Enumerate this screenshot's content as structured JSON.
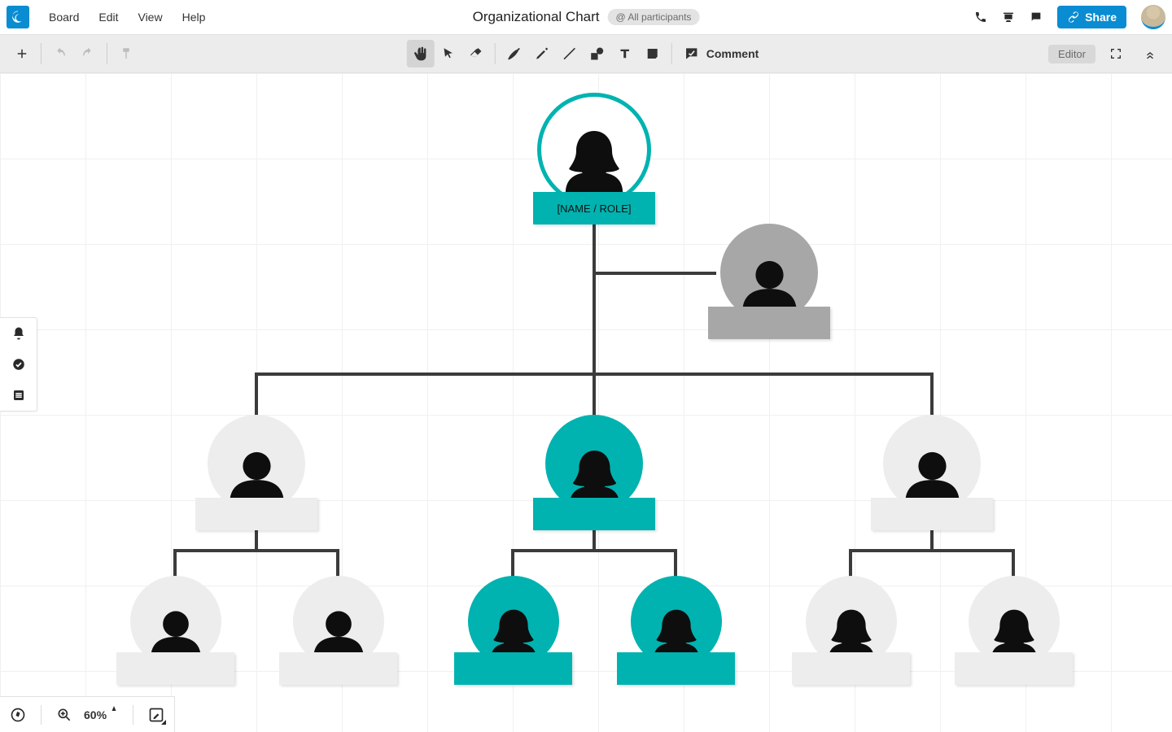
{
  "menu": {
    "board": "Board",
    "edit": "Edit",
    "view": "View",
    "help": "Help"
  },
  "doc": {
    "title": "Organizational Chart",
    "participants_label": "@ All participants"
  },
  "share": {
    "label": "Share"
  },
  "toolbar": {
    "comment_label": "Comment",
    "role_label": "Editor"
  },
  "bottom": {
    "zoom": "60%"
  },
  "colors": {
    "teal": "#00b3b0",
    "grey": "#a7a7a7",
    "light": "#ededed",
    "line": "#3b3b3b",
    "brand": "#0a8cd2"
  },
  "chart": {
    "root": {
      "label": "[NAME / ROLE]"
    }
  },
  "chart_data": {
    "type": "tree",
    "title": "Organizational Chart",
    "nodes": [
      {
        "id": "n1",
        "label": "[NAME / ROLE]",
        "gender": "female",
        "circle": "teal-ring",
        "plate": "teal",
        "parent": null
      },
      {
        "id": "n1a",
        "label": "",
        "gender": "male",
        "circle": "grey",
        "plate": "grey",
        "parent": "n1",
        "assistant": true
      },
      {
        "id": "n2",
        "label": "",
        "gender": "male",
        "circle": "light",
        "plate": "light",
        "parent": "n1"
      },
      {
        "id": "n3",
        "label": "",
        "gender": "female",
        "circle": "teal-fill",
        "plate": "teal",
        "parent": "n1"
      },
      {
        "id": "n4",
        "label": "",
        "gender": "male",
        "circle": "light",
        "plate": "light",
        "parent": "n1"
      },
      {
        "id": "n2a",
        "label": "",
        "gender": "male",
        "circle": "light",
        "plate": "light",
        "parent": "n2"
      },
      {
        "id": "n2b",
        "label": "",
        "gender": "male",
        "circle": "light",
        "plate": "light",
        "parent": "n2"
      },
      {
        "id": "n3a",
        "label": "",
        "gender": "female",
        "circle": "teal-fill",
        "plate": "teal",
        "parent": "n3"
      },
      {
        "id": "n3b",
        "label": "",
        "gender": "female",
        "circle": "teal-fill",
        "plate": "teal",
        "parent": "n3"
      },
      {
        "id": "n4a",
        "label": "",
        "gender": "female",
        "circle": "light",
        "plate": "light",
        "parent": "n4"
      },
      {
        "id": "n4b",
        "label": "",
        "gender": "female",
        "circle": "light",
        "plate": "light",
        "parent": "n4"
      }
    ]
  }
}
